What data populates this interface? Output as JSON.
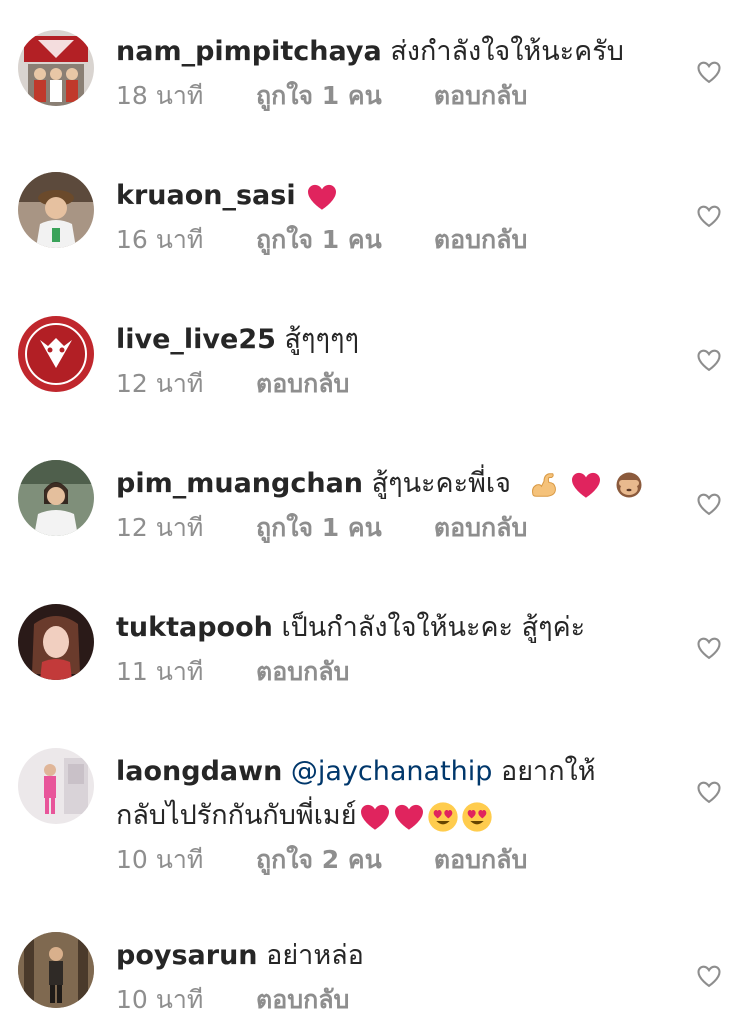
{
  "comments": [
    {
      "username": "nam_pimpitchaya",
      "text": "ส่งกำลังใจให้นะครับ",
      "time": "18 นาที",
      "likes": "ถูกใจ 1 คน",
      "reply": "ตอบกลับ"
    },
    {
      "username": "kruaon_sasi",
      "text": "",
      "time": "16 นาที",
      "likes": "ถูกใจ 1 คน",
      "reply": "ตอบกลับ"
    },
    {
      "username": "live_live25",
      "text": "สู้ๆๆๆๆ",
      "time": "12 นาที",
      "likes": "",
      "reply": "ตอบกลับ"
    },
    {
      "username": "pim_muangchan",
      "text": "สู้ๆนะคะพี่เจ",
      "time": "12 นาที",
      "likes": "ถูกใจ 1 คน",
      "reply": "ตอบกลับ"
    },
    {
      "username": "tuktapooh",
      "text": "เป็นกำลังใจให้นะคะ สู้ๆค่ะ",
      "time": "11 นาที",
      "likes": "",
      "reply": "ตอบกลับ"
    },
    {
      "username": "laongdawn",
      "mention": "@jaychanathip",
      "text": "อยากให้",
      "text2": "กลับไปรักกันกับพี่เมย์",
      "time": "10 นาที",
      "likes": "ถูกใจ 2 คน",
      "reply": "ตอบกลับ"
    },
    {
      "username": "poysarun",
      "text": "อย่าหล่อ",
      "time": "10 นาที",
      "likes": "",
      "reply": "ตอบกลับ"
    }
  ],
  "colors": {
    "username": "#262626",
    "meta": "#8e8e8e",
    "mention": "#00376b",
    "heart_emoji": "#e0245e"
  },
  "icons": {
    "like_button": "heart-outline-icon",
    "emoji_heart": "red-heart-emoji",
    "emoji_muscle": "flexed-biceps-emoji",
    "emoji_monkey": "see-no-evil-monkey-emoji",
    "emoji_heart_eyes": "smiling-face-with-heart-eyes-emoji"
  }
}
